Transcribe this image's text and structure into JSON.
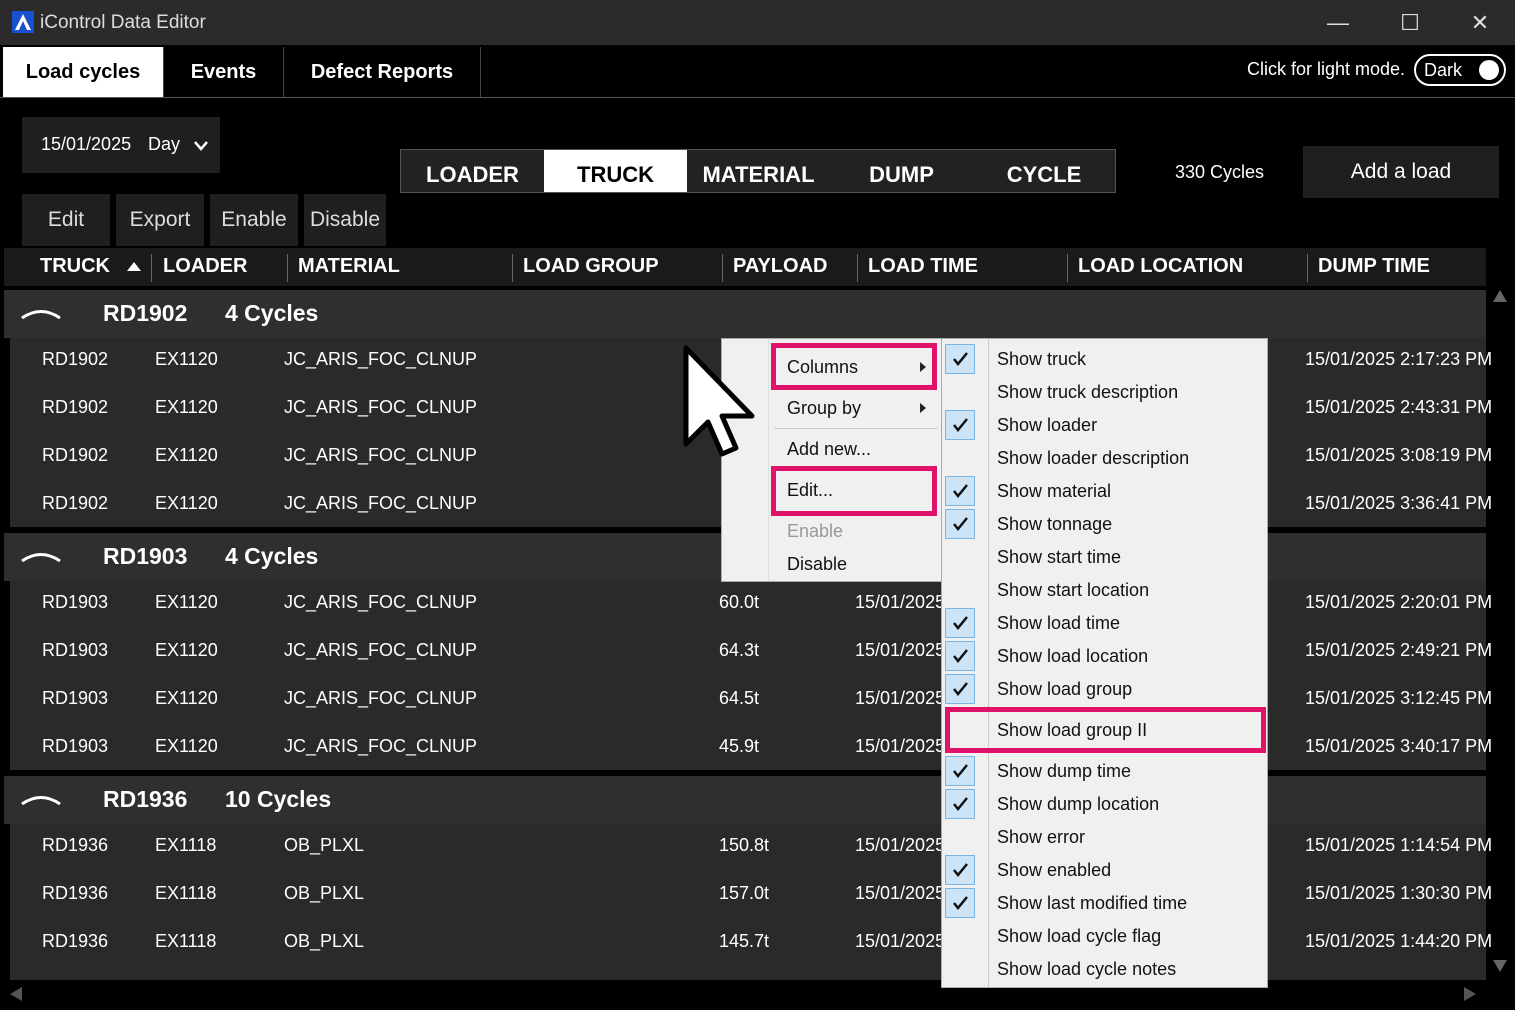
{
  "window": {
    "title": "iControl Data Editor",
    "minimize": "—",
    "maximize": "☐",
    "close": "✕"
  },
  "tabs": [
    "Load cycles",
    "Events",
    "Defect Reports"
  ],
  "theme": {
    "hint": "Click for light mode.",
    "toggle_label": "Dark"
  },
  "filter": {
    "date": "15/01/2025",
    "period": "Day"
  },
  "actions": {
    "edit": "Edit",
    "export": "Export",
    "enable": "Enable",
    "disable": "Disable"
  },
  "segments": [
    "LOADER",
    "TRUCK",
    "MATERIAL",
    "DUMP",
    "CYCLE"
  ],
  "cycle_count": "330 Cycles",
  "add_load": "Add a load",
  "columns": [
    "TRUCK",
    "LOADER",
    "MATERIAL",
    "LOAD GROUP",
    "PAYLOAD",
    "LOAD TIME",
    "LOAD LOCATION",
    "DUMP TIME"
  ],
  "groups": [
    {
      "name": "RD1902",
      "count": "4 Cycles",
      "rows": [
        {
          "truck": "RD1902",
          "loader": "EX1120",
          "material": "JC_ARIS_FOC_CLNUP",
          "payload": "",
          "load_time": "",
          "dump_time": "15/01/2025 2:17:23 PM"
        },
        {
          "truck": "RD1902",
          "loader": "EX1120",
          "material": "JC_ARIS_FOC_CLNUP",
          "payload": "",
          "load_time": "",
          "dump_time": "15/01/2025 2:43:31 PM"
        },
        {
          "truck": "RD1902",
          "loader": "EX1120",
          "material": "JC_ARIS_FOC_CLNUP",
          "payload": "",
          "load_time": "",
          "dump_time": "15/01/2025 3:08:19 PM"
        },
        {
          "truck": "RD1902",
          "loader": "EX1120",
          "material": "JC_ARIS_FOC_CLNUP",
          "payload": "",
          "load_time": "",
          "dump_time": "15/01/2025 3:36:41 PM"
        }
      ]
    },
    {
      "name": "RD1903",
      "count": "4 Cycles",
      "rows": [
        {
          "truck": "RD1903",
          "loader": "EX1120",
          "material": "JC_ARIS_FOC_CLNUP",
          "payload": "60.0t",
          "load_time": "15/01/2025",
          "dump_time": "15/01/2025 2:20:01 PM"
        },
        {
          "truck": "RD1903",
          "loader": "EX1120",
          "material": "JC_ARIS_FOC_CLNUP",
          "payload": "64.3t",
          "load_time": "15/01/2025",
          "dump_time": "15/01/2025 2:49:21 PM"
        },
        {
          "truck": "RD1903",
          "loader": "EX1120",
          "material": "JC_ARIS_FOC_CLNUP",
          "payload": "64.5t",
          "load_time": "15/01/2025",
          "dump_time": "15/01/2025 3:12:45 PM"
        },
        {
          "truck": "RD1903",
          "loader": "EX1120",
          "material": "JC_ARIS_FOC_CLNUP",
          "payload": "45.9t",
          "load_time": "15/01/2025",
          "dump_time": "15/01/2025 3:40:17 PM"
        }
      ]
    },
    {
      "name": "RD1936",
      "count": "10 Cycles",
      "rows": [
        {
          "truck": "RD1936",
          "loader": "EX1118",
          "material": "OB_PLXL",
          "payload": "150.8t",
          "load_time": "15/01/2025",
          "dump_time": "15/01/2025 1:14:54 PM"
        },
        {
          "truck": "RD1936",
          "loader": "EX1118",
          "material": "OB_PLXL",
          "payload": "157.0t",
          "load_time": "15/01/2025",
          "dump_time": "15/01/2025 1:30:30 PM"
        },
        {
          "truck": "RD1936",
          "loader": "EX1118",
          "material": "OB_PLXL",
          "payload": "145.7t",
          "load_time": "15/01/2025",
          "dump_time": "15/01/2025 1:44:20 PM"
        }
      ]
    }
  ],
  "context_menu": [
    {
      "label": "Columns",
      "submenu": true,
      "highlighted": true
    },
    {
      "label": "Group by",
      "submenu": true,
      "highlighted": false
    },
    {
      "label": "Add new...",
      "submenu": false,
      "highlighted": false
    },
    {
      "label": "Edit...",
      "submenu": false,
      "highlighted": true
    },
    {
      "label": "Enable",
      "submenu": false,
      "highlighted": false,
      "disabled": true
    },
    {
      "label": "Disable",
      "submenu": false,
      "highlighted": false
    }
  ],
  "columns_menu": [
    {
      "label": "Show truck",
      "checked": true
    },
    {
      "label": "Show truck description",
      "checked": false
    },
    {
      "label": "Show loader",
      "checked": true
    },
    {
      "label": "Show loader description",
      "checked": false
    },
    {
      "label": "Show material",
      "checked": true
    },
    {
      "label": "Show tonnage",
      "checked": true
    },
    {
      "label": "Show start time",
      "checked": false
    },
    {
      "label": "Show start location",
      "checked": false
    },
    {
      "label": "Show load time",
      "checked": true
    },
    {
      "label": "Show load location",
      "checked": true
    },
    {
      "label": "Show load group",
      "checked": true
    },
    {
      "label": "Show load group II",
      "checked": false,
      "highlighted": true
    },
    {
      "label": "Show dump time",
      "checked": true
    },
    {
      "label": "Show dump location",
      "checked": true
    },
    {
      "label": "Show error",
      "checked": false
    },
    {
      "label": "Show enabled",
      "checked": true
    },
    {
      "label": "Show last modified time",
      "checked": true
    },
    {
      "label": "Show load cycle flag",
      "checked": false
    },
    {
      "label": "Show load cycle notes",
      "checked": false
    }
  ],
  "colors": {
    "highlight": "#e0126a",
    "check_bg": "#cde4f7"
  }
}
